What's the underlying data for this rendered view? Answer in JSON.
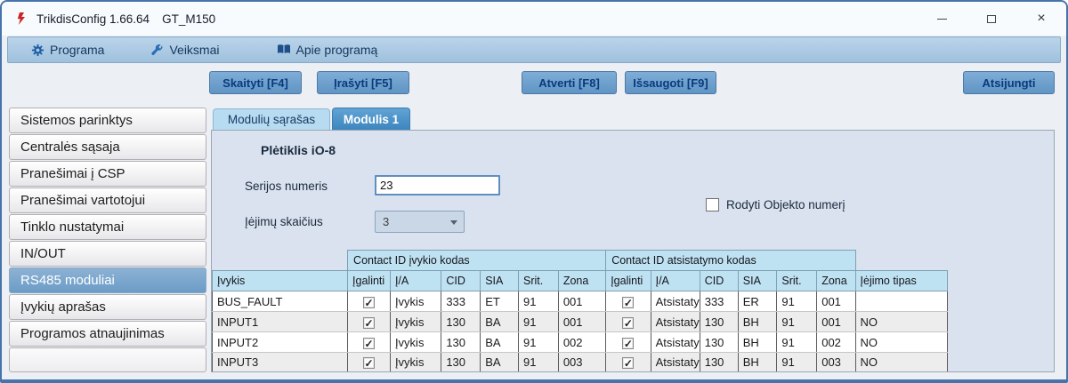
{
  "window": {
    "title": "TrikdisConfig 1.66.64",
    "device": "GT_M150",
    "close_glyph": "×"
  },
  "menu": {
    "items": [
      {
        "icon": "gear-icon",
        "label": "Programa"
      },
      {
        "icon": "wrench-icon",
        "label": "Veiksmai"
      },
      {
        "icon": "book-icon",
        "label": "Apie programą"
      }
    ]
  },
  "toolbar": {
    "read": "Skaityti [F4]",
    "write": "Įrašyti [F5]",
    "open": "Atverti [F8]",
    "save": "Išsaugoti [F9]",
    "disconnect": "Atsijungti"
  },
  "sidebar": {
    "items": [
      {
        "label": "Sistemos parinktys",
        "active": false
      },
      {
        "label": "Centralės sąsaja",
        "active": false
      },
      {
        "label": "Pranešimai į CSP",
        "active": false
      },
      {
        "label": "Pranešimai vartotojui",
        "active": false
      },
      {
        "label": "Tinklo nustatymai",
        "active": false
      },
      {
        "label": "IN/OUT",
        "active": false
      },
      {
        "label": "RS485 moduliai",
        "active": true
      },
      {
        "label": "Įvykių aprašas",
        "active": false
      },
      {
        "label": "Programos atnaujinimas",
        "active": false
      }
    ]
  },
  "tabs": [
    {
      "label": "Modulių sąrašas",
      "active": false
    },
    {
      "label": "Modulis 1",
      "active": true
    }
  ],
  "panel": {
    "heading": "Plėtiklis iO-8",
    "serial": {
      "label": "Serijos numeris",
      "value": "23"
    },
    "inputs_count": {
      "label": "Įėjimų skaičius",
      "value": "3"
    },
    "show_object_number": {
      "label": "Rodyti Objekto numerį",
      "checked": false
    }
  },
  "table": {
    "group_headers": [
      "Contact ID įvykio kodas",
      "Contact ID atsistatymo kodas"
    ],
    "columns": [
      "Įvykis",
      "Įgalinti",
      "Į/A",
      "CID",
      "SIA",
      "Srit.",
      "Zona",
      "Įgalinti",
      "Į/A",
      "CID",
      "SIA",
      "Srit.",
      "Zona",
      "Įėjimo tipas"
    ],
    "check_glyph": "✓",
    "rows": [
      [
        "BUS_FAULT",
        true,
        "Įvykis",
        "333",
        "ET",
        "91",
        "001",
        true,
        "Atsistaty",
        "333",
        "ER",
        "91",
        "001",
        ""
      ],
      [
        "INPUT1",
        true,
        "Įvykis",
        "130",
        "BA",
        "91",
        "001",
        true,
        "Atsistaty",
        "130",
        "BH",
        "91",
        "001",
        "NO"
      ],
      [
        "INPUT2",
        true,
        "Įvykis",
        "130",
        "BA",
        "91",
        "002",
        true,
        "Atsistaty",
        "130",
        "BH",
        "91",
        "002",
        "NO"
      ],
      [
        "INPUT3",
        true,
        "Įvykis",
        "130",
        "BA",
        "91",
        "003",
        true,
        "Atsistaty",
        "130",
        "BH",
        "91",
        "003",
        "NO"
      ]
    ]
  }
}
